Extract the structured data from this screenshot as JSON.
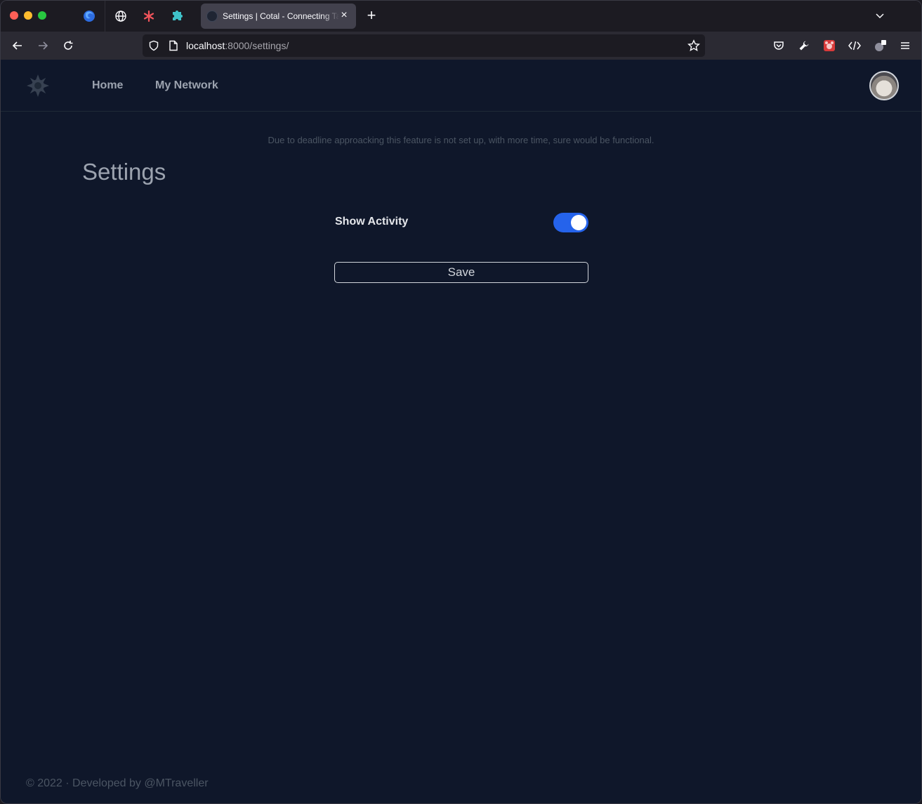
{
  "browser": {
    "active_tab": {
      "title": "Settings | Cotal - Connecting Ta"
    },
    "pinned_tabs": [
      "firefox-icon",
      "globe-icon",
      "asterisk-icon",
      "puzzle-icon"
    ],
    "url": {
      "host": "localhost",
      "rest": ":8000/settings/"
    },
    "new_tab_label": "+",
    "close_tab_label": "×"
  },
  "site": {
    "nav": {
      "home": "Home",
      "network": "My Network"
    },
    "notice": "Due to deadline approacking this feature is not set up, with more time, sure would be functional.",
    "title": "Settings",
    "settings": {
      "show_activity_label": "Show Activity",
      "show_activity_enabled": true
    },
    "save_label": "Save",
    "footer": "© 2022 · Developed by @MTraveller"
  },
  "colors": {
    "page_bg": "#0f172a",
    "toggle_on": "#2563eb",
    "nav_text": "#9ca3af"
  }
}
